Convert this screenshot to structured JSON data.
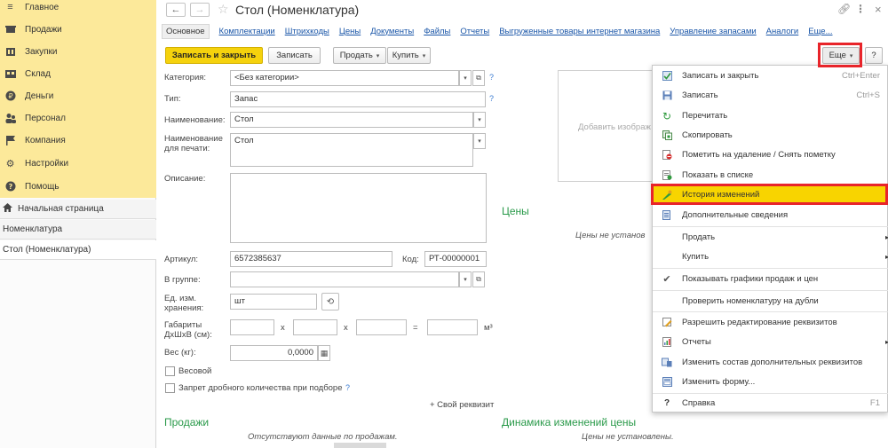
{
  "sidebar": {
    "sections": [
      {
        "label": "Главное",
        "icon": "hamburger-icon"
      },
      {
        "label": "Продажи",
        "icon": "cart-icon"
      },
      {
        "label": "Закупки",
        "icon": "basket-icon"
      },
      {
        "label": "Склад",
        "icon": "warehouse-icon"
      },
      {
        "label": "Деньги",
        "icon": "money-icon"
      },
      {
        "label": "Персонал",
        "icon": "people-icon"
      },
      {
        "label": "Компания",
        "icon": "flag-icon"
      },
      {
        "label": "Настройки",
        "icon": "gear-icon"
      },
      {
        "label": "Помощь",
        "icon": "help-icon"
      }
    ],
    "home": "Начальная страница",
    "open_windows": [
      "Номенклатура",
      "Стол (Номенклатура)"
    ]
  },
  "window": {
    "title": "Стол (Номенклатура)"
  },
  "tabs": [
    "Основное",
    "Комплектации",
    "Штрихкоды",
    "Цены",
    "Документы",
    "Файлы",
    "Отчеты",
    "Выгруженные товары интернет магазина",
    "Управление запасами",
    "Аналоги",
    "Еще..."
  ],
  "toolbar": {
    "save_close": "Записать и закрыть",
    "save": "Записать",
    "sell": "Продать",
    "buy": "Купить",
    "more": "Еще",
    "help": "?"
  },
  "form": {
    "category_label": "Категория:",
    "category_value": "<Без категории>",
    "type_label": "Тип:",
    "type_value": "Запас",
    "name_label": "Наименование:",
    "name_value": "Стол",
    "print_name_label_1": "Наименование",
    "print_name_label_2": "для печати:",
    "print_name_value": "Стол",
    "description_label": "Описание:",
    "article_label": "Артикул:",
    "article_value": "6572385637",
    "code_label": "Код:",
    "code_value": "РТ-00000001",
    "group_label": "В группе:",
    "unit_label_1": "Ед. изм.",
    "unit_label_2": "хранения:",
    "unit_value": "шт",
    "dims_label_1": "Габариты",
    "dims_label_2": "ДхШхВ (см):",
    "x1": "x",
    "x2": "x",
    "eq": "=",
    "m3": "м³",
    "weight_label": "Вес (кг):",
    "weight_value": "0,0000",
    "weight_check": "Весовой",
    "fraction_check": "Запрет дробного количества при подборе",
    "own_prop": "+ Свой реквизит"
  },
  "right": {
    "add_image": "Добавить изображ",
    "prices_title": "Цены",
    "prices_empty": "Цены не установ",
    "dynamics_title": "Динамика изменений цены",
    "dynamics_empty": "Цены не установлены."
  },
  "sales": {
    "title": "Продажи",
    "empty": "Отсутствуют данные по продажам."
  },
  "menu": {
    "items": [
      {
        "label": "Записать и закрыть",
        "key": "Ctrl+Enter",
        "icon": "save-close-icon"
      },
      {
        "label": "Записать",
        "key": "Ctrl+S",
        "icon": "floppy-icon"
      },
      {
        "label": "Перечитать",
        "key": "",
        "icon": "refresh-icon"
      },
      {
        "label": "Скопировать",
        "key": "",
        "icon": "copy-icon"
      },
      {
        "label": "Пометить на удаление / Снять пометку",
        "key": "",
        "icon": "delete-mark-icon"
      },
      {
        "label": "Показать в списке",
        "key": "",
        "icon": "show-in-list-icon"
      },
      {
        "label": "История изменений",
        "key": "",
        "icon": "history-icon"
      },
      {
        "label": "Дополнительные сведения",
        "key": "",
        "icon": "info-doc-icon"
      },
      {
        "label": "Продать",
        "key": "",
        "icon": ""
      },
      {
        "label": "Купить",
        "key": "",
        "icon": ""
      },
      {
        "label": "Показывать графики продаж и цен",
        "key": "",
        "icon": "checkmark-icon"
      },
      {
        "label": "Проверить номенклатуру на дубли",
        "key": "",
        "icon": ""
      },
      {
        "label": "Разрешить редактирование реквизитов",
        "key": "",
        "icon": "edit-props-icon"
      },
      {
        "label": "Отчеты",
        "key": "",
        "icon": "reports-icon"
      },
      {
        "label": "Изменить состав дополнительных реквизитов",
        "key": "",
        "icon": "change-props-icon"
      },
      {
        "label": "Изменить форму...",
        "key": "",
        "icon": "form-icon"
      },
      {
        "label": "Справка",
        "key": "F1",
        "icon": "help-q-icon"
      }
    ]
  },
  "colors": {
    "sidebar_top": "#fce99a",
    "accent_yellow": "#f5d20d",
    "highlight": "#f8d400",
    "link": "#1a56a8",
    "green": "#2a9a4a",
    "annotation_red": "#e8242a"
  }
}
